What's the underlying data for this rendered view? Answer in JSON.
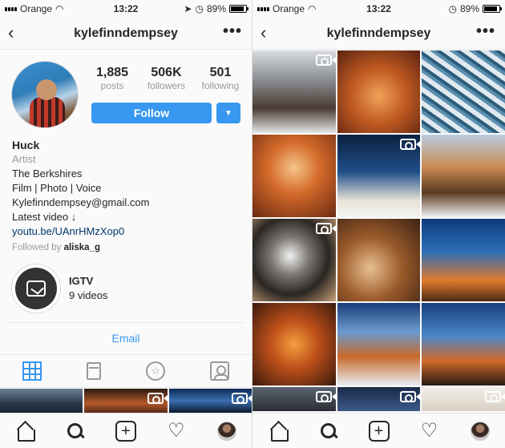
{
  "status_left": {
    "carrier": "Orange",
    "time": "13:22",
    "battery": "89%",
    "battery_level": 0.89
  },
  "status_right": {
    "carrier": "Orange",
    "time": "13:22",
    "battery": "89%",
    "battery_level": 0.89
  },
  "left_nav": {
    "back_icon": "chevron-left-icon",
    "title": "kylefinndempsey",
    "more": "•••"
  },
  "right_nav": {
    "back_icon": "chevron-left-icon",
    "title": "kylefinndempsey",
    "more": "•••"
  },
  "stats": [
    {
      "num": "1,885",
      "label": "posts"
    },
    {
      "num": "506K",
      "label": "followers"
    },
    {
      "num": "501",
      "label": "following"
    }
  ],
  "follow_label": "Follow",
  "dropdown_glyph": "▼",
  "bio": {
    "name": "Huck",
    "category": "Artist",
    "lines": [
      "The Berkshires",
      "Film | Photo | Voice",
      "Kylefinndempsey@gmail.com",
      "Latest video ↓"
    ],
    "link": "youtu.be/UAnrHMzXop0",
    "followed_prefix": "Followed by",
    "followed_user": "aliska_g"
  },
  "igtv": {
    "title": "IGTV",
    "subtitle": "9 videos"
  },
  "email_label": "Email",
  "tabs": [
    "grid-icon",
    "feed-icon",
    "star-icon",
    "tagged-icon"
  ],
  "bottom_nav": [
    "home-icon",
    "search-icon",
    "add-icon",
    "heart-icon",
    "profile-avatar"
  ],
  "colors": {
    "accent": "#3897f0",
    "link": "#003569",
    "muted": "#999999"
  },
  "strip": [
    {
      "bg": "linear-gradient(180deg,#6e7f96,#2b3a4d 60%,#1a2430)",
      "video": false
    },
    {
      "bg": "linear-gradient(180deg,#2a1a14,#b35a2a 60%,#5a2a18)",
      "video": true
    },
    {
      "bg": "linear-gradient(180deg,#0e2a55,#3b6fb0 50%,#0b1a30)",
      "video": true
    }
  ],
  "grid": [
    {
      "bg": "linear-gradient(180deg,#d9dde1 0%,#8b8f94 35%,#4a3c33 70%,#e4e6e8 100%)",
      "video": true
    },
    {
      "bg": "radial-gradient(circle at 50% 55%,#f0a35a 0%,#c05a22 45%,#5a2210 100%)",
      "video": false
    },
    {
      "bg": "repeating-linear-gradient(35deg,#dfe9ef 0 6px,#5b8fb0 6px 10px,#2d5c7a 10px 14px)",
      "video": false
    },
    {
      "bg": "radial-gradient(circle at 50% 40%,#f6c48a 0%,#d46a2a 40%,#6b2a12 100%)",
      "video": false
    },
    {
      "bg": "linear-gradient(180deg,#0b2140 0%,#1f4f8a 45%,#e8e2d6 80%,#f4f4f4 100%)",
      "video": true
    },
    {
      "bg": "linear-gradient(180deg,#b9cde0 0%,#c98a52 40%,#5a3a22 70%,#f2f2f2 100%)",
      "video": false
    },
    {
      "bg": "radial-gradient(circle at 45% 45%,#f2f2f2 0%,#7a7670 30%,#2a2622 60%,#c9a07a 100%)",
      "video": true
    },
    {
      "bg": "radial-gradient(circle at 40% 60%,#e8c090 0%,#9a5a2a 45%,#3a2214 100%)",
      "video": false
    },
    {
      "bg": "linear-gradient(180deg,#0e3a7a 0%,#2e6fb8 40%,#e07a2a 75%,#4a2a14 100%)",
      "video": false
    },
    {
      "bg": "radial-gradient(circle at 50% 50%,#f4a040 0%,#c0501a 40%,#3a1a0e 100%)",
      "video": false
    },
    {
      "bg": "linear-gradient(180deg,#1b3e7a 0%,#6a9ad0 35%,#c86a2a 65%,#e8eef4 100%)",
      "video": false
    },
    {
      "bg": "linear-gradient(180deg,#1a3f80 0%,#4a86c8 40%,#d06a2a 70%,#2a1a12 100%)",
      "video": false
    },
    {
      "bg": "linear-gradient(180deg,#5a6470,#2a2e34)",
      "video": true
    },
    {
      "bg": "linear-gradient(180deg,#1a2a45,#3a5a8a)",
      "video": true
    },
    {
      "bg": "linear-gradient(180deg,#f2eee8,#d8cfc2)",
      "video": true
    }
  ]
}
